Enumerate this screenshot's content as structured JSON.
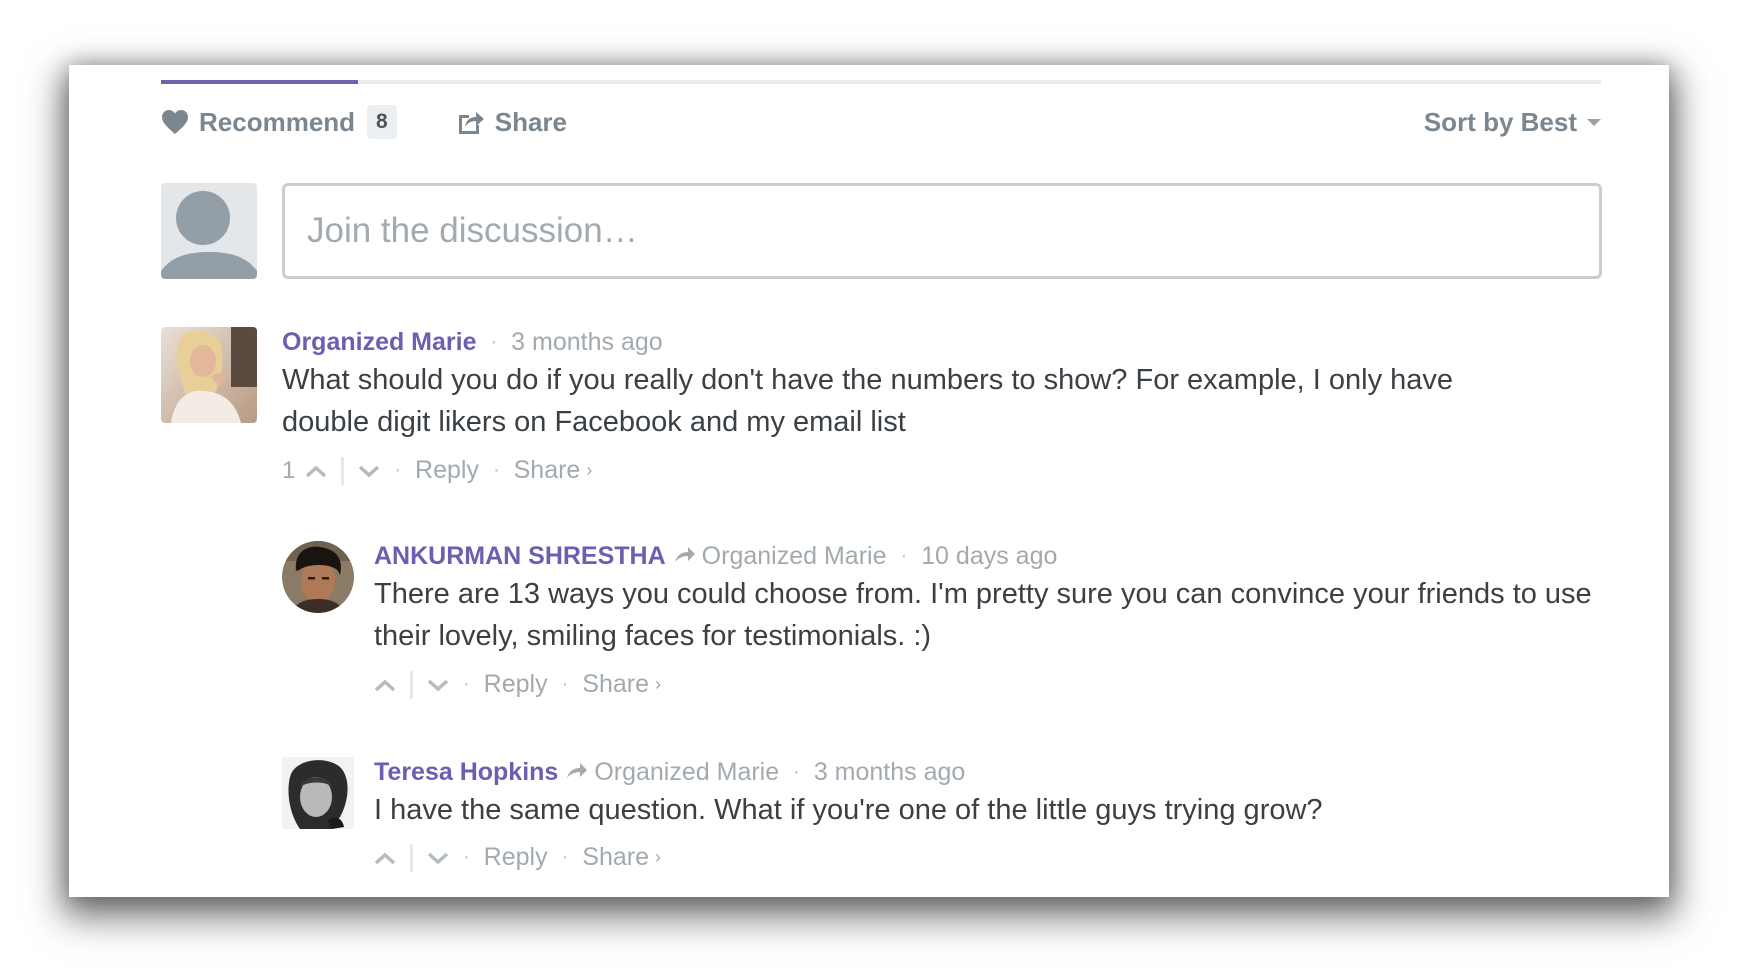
{
  "toolbar": {
    "recommend_label": "Recommend",
    "recommend_count": "8",
    "share_label": "Share",
    "sort_label": "Sort by Best"
  },
  "new_comment": {
    "placeholder": "Join the discussion…"
  },
  "colors": {
    "accent": "#6c64ad",
    "author": "#6a5fb0",
    "muted": "#a2aab0",
    "toolbar_text": "#7a8791",
    "body_text": "#3b4045"
  },
  "comments": [
    {
      "author": "Organized Marie",
      "time": "3 months ago",
      "body": "What should you do if you really don't have the numbers to show? For example, I only have double digit likers on Facebook and my email list",
      "votes": "1",
      "reply_label": "Reply",
      "share_label": "Share",
      "replies": [
        {
          "author": "ANKURMAN SHRESTHA",
          "in_reply_to": "Organized Marie",
          "time": "10 days ago",
          "body": "There are 13 ways you could choose from. I'm pretty sure you can convince your friends to use their lovely, smiling faces for testimonials. :)",
          "reply_label": "Reply",
          "share_label": "Share"
        },
        {
          "author": "Teresa Hopkins",
          "in_reply_to": "Organized Marie",
          "time": "3 months ago",
          "body": "I have the same question. What if you're one of the little guys trying grow?",
          "reply_label": "Reply",
          "share_label": "Share"
        }
      ]
    }
  ]
}
